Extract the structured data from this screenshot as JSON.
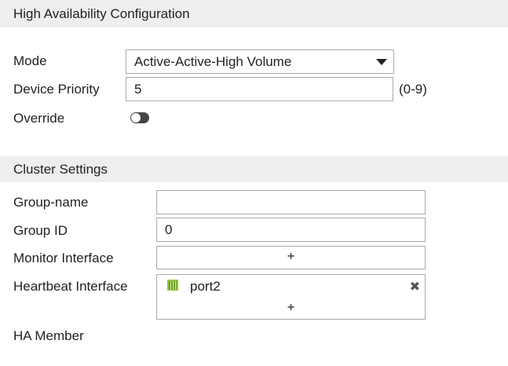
{
  "header": {
    "title": "High Availability Configuration"
  },
  "mode": {
    "label": "Mode",
    "value": "Active-Active-High Volume"
  },
  "priority": {
    "label": "Device Priority",
    "value": "5",
    "hint": "(0-9)"
  },
  "override": {
    "label": "Override",
    "enabled": false
  },
  "cluster": {
    "title": "Cluster Settings",
    "group_name": {
      "label": "Group-name",
      "value": ""
    },
    "group_id": {
      "label": "Group ID",
      "value": "0"
    },
    "monitor": {
      "label": "Monitor Interface",
      "add": "+"
    },
    "heartbeat": {
      "label": "Heartbeat Interface",
      "items": [
        "port2"
      ],
      "add": "+",
      "remove": "✖"
    },
    "ha_member": {
      "label": "HA Member"
    }
  }
}
